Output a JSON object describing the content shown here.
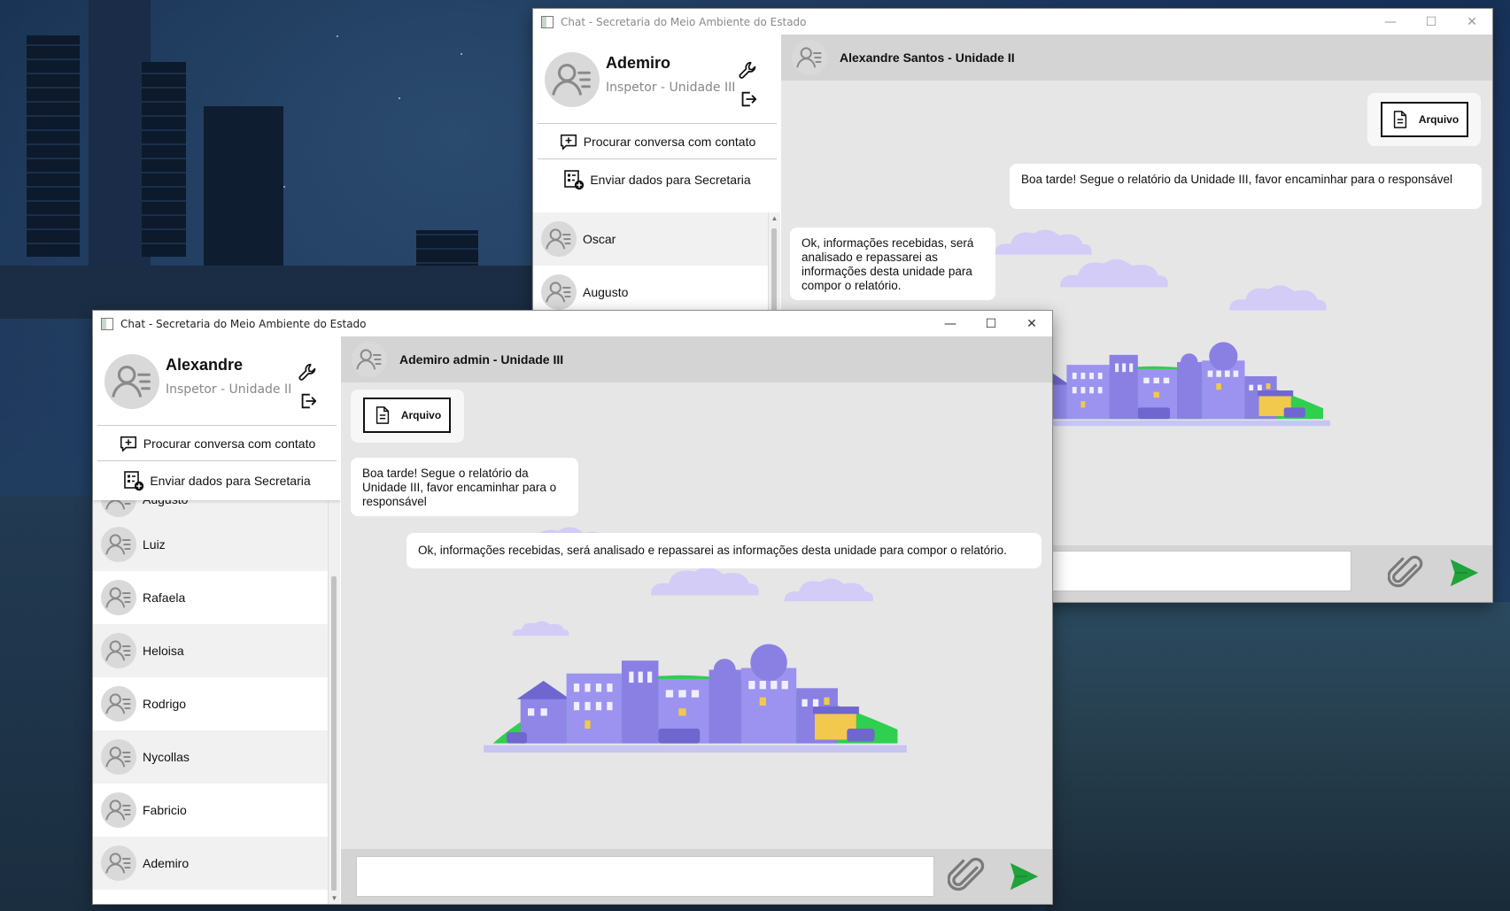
{
  "window_back": {
    "title": "Chat - Secretaria do Meio Ambiente do Estado",
    "window_controls": {
      "minimize": "—",
      "maximize": "☐",
      "close": "✕"
    },
    "user": {
      "name": "Ademiro",
      "role": "Inspetor - Unidade III"
    },
    "actions": {
      "search": "Procurar conversa com contato",
      "send_data": "Enviar dados para Secretaria"
    },
    "contacts": [
      {
        "name": "Oscar"
      },
      {
        "name": "Augusto"
      }
    ],
    "chat": {
      "contact_header": "Alexandre Santos - Unidade II",
      "file_label": "Arquivo",
      "messages": [
        "Boa tarde! Segue o relatório da Unidade III, favor encaminhar para o responsável",
        "Ok, informações recebidas, será analisado e repassarei as informações desta unidade para compor o relatório."
      ],
      "input_value": ""
    }
  },
  "window_front": {
    "title": "Chat - Secretaria do Meio Ambiente do Estado",
    "window_controls": {
      "minimize": "—",
      "maximize": "☐",
      "close": "✕"
    },
    "user": {
      "name": "Alexandre",
      "role": "Inspetor - Unidade II"
    },
    "actions": {
      "search": "Procurar conversa com contato",
      "send_data": "Enviar dados para Secretaria"
    },
    "contacts": [
      {
        "name": "Augusto"
      },
      {
        "name": "Luiz"
      },
      {
        "name": "Rafaela"
      },
      {
        "name": "Heloisa"
      },
      {
        "name": "Rodrigo"
      },
      {
        "name": "Nycollas"
      },
      {
        "name": "Fabricio"
      },
      {
        "name": "Ademiro"
      }
    ],
    "chat": {
      "contact_header": "Ademiro admin - Unidade III",
      "file_label": "Arquivo",
      "messages": [
        "Boa tarde! Segue o relatório da Unidade III, favor encaminhar para o responsável",
        "Ok, informações recebidas, será analisado e repassarei as informações desta unidade para compor o relatório."
      ],
      "input_value": ""
    }
  },
  "colors": {
    "send_green": "#1fa33a",
    "illustration_green": "#2fcf4f",
    "illustration_purple": "#8f86e8",
    "header_gray": "#d4d4d4",
    "chat_bg": "#e6e6e6"
  },
  "icons": [
    "user-avatar-icon",
    "wrench-icon",
    "logout-icon",
    "chat-plus-icon",
    "data-send-icon",
    "document-icon",
    "paperclip-icon",
    "send-arrow-icon"
  ]
}
